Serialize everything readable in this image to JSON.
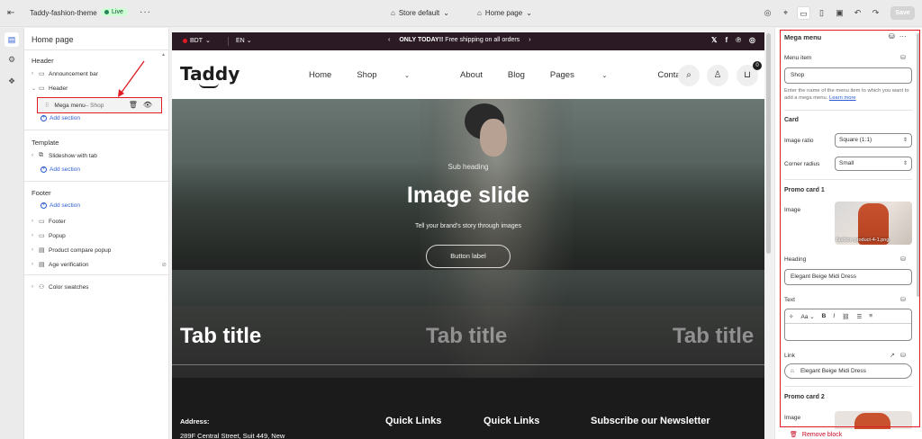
{
  "topbar": {
    "theme_name": "Taddy-fashion-theme",
    "live_badge": "Live",
    "more": "···",
    "store_selector": "Store default",
    "page_selector": "Home page",
    "save_label": "Save"
  },
  "left_panel": {
    "title": "Home page",
    "sections": {
      "header": "Header",
      "template": "Template",
      "footer": "Footer"
    },
    "header_items": [
      {
        "label": "Announcement bar"
      },
      {
        "label": "Header"
      }
    ],
    "mega_menu": {
      "label": "Mega menu",
      "sub": " – Shop"
    },
    "add_section": "Add section",
    "template_items": [
      {
        "label": "Slideshow with tab"
      }
    ],
    "footer_items": [
      {
        "label": "Footer"
      },
      {
        "label": "Popup"
      },
      {
        "label": "Product compare popup"
      },
      {
        "label": "Age verification"
      }
    ],
    "color_swatches": "Color swatches"
  },
  "site": {
    "currency": "BDT",
    "language": "EN",
    "announcement_bold": "ONLY TODAY!!",
    "announcement_text": " Free shipping on all orders",
    "logo": "Taddy",
    "nav": [
      "Home",
      "Shop",
      "About",
      "Blog",
      "Pages",
      "Contact"
    ],
    "cart_count": "0",
    "hero": {
      "subheading": "Sub heading",
      "title": "Image slide",
      "description": "Tell your brand's story through images",
      "button": "Button label"
    },
    "tabs": [
      "Tab title",
      "Tab title",
      "Tab title"
    ],
    "footer": {
      "address_label": "Address:",
      "address_line": "289F Central Street, Suit 449, New",
      "quick_links_1": "Quick Links",
      "quick_links_2": "Quick Links",
      "newsletter": "Subscribe our Newsletter"
    }
  },
  "right_panel": {
    "title": "Mega menu",
    "more": "···",
    "menu_item_label": "Menu item",
    "menu_item_value": "Shop",
    "help_text": "Enter the name of the menu item to which you want to add a mega menu.",
    "learn_more": "Learn more",
    "card_heading": "Card",
    "image_ratio_label": "Image ratio",
    "image_ratio_value": "Square (1:1)",
    "corner_radius_label": "Corner radius",
    "corner_radius_value": "Small",
    "promo1_heading": "Promo card 1",
    "image_label": "Image",
    "image_caption": "fashion-product-4-1.png",
    "heading_label": "Heading",
    "heading_value": "Elegant Beige Midi Dress",
    "text_label": "Text",
    "link_label": "Link",
    "link_value": "Elegant Beige Midi Dress",
    "promo2_heading": "Promo card 2",
    "image2_label": "Image",
    "remove_block": "Remove block"
  },
  "colors": {
    "accent_blue": "#2b5cd1",
    "highlight_red": "#e01b24",
    "live_green": "#cdfed4",
    "announcement_bg": "#2b1a23"
  }
}
